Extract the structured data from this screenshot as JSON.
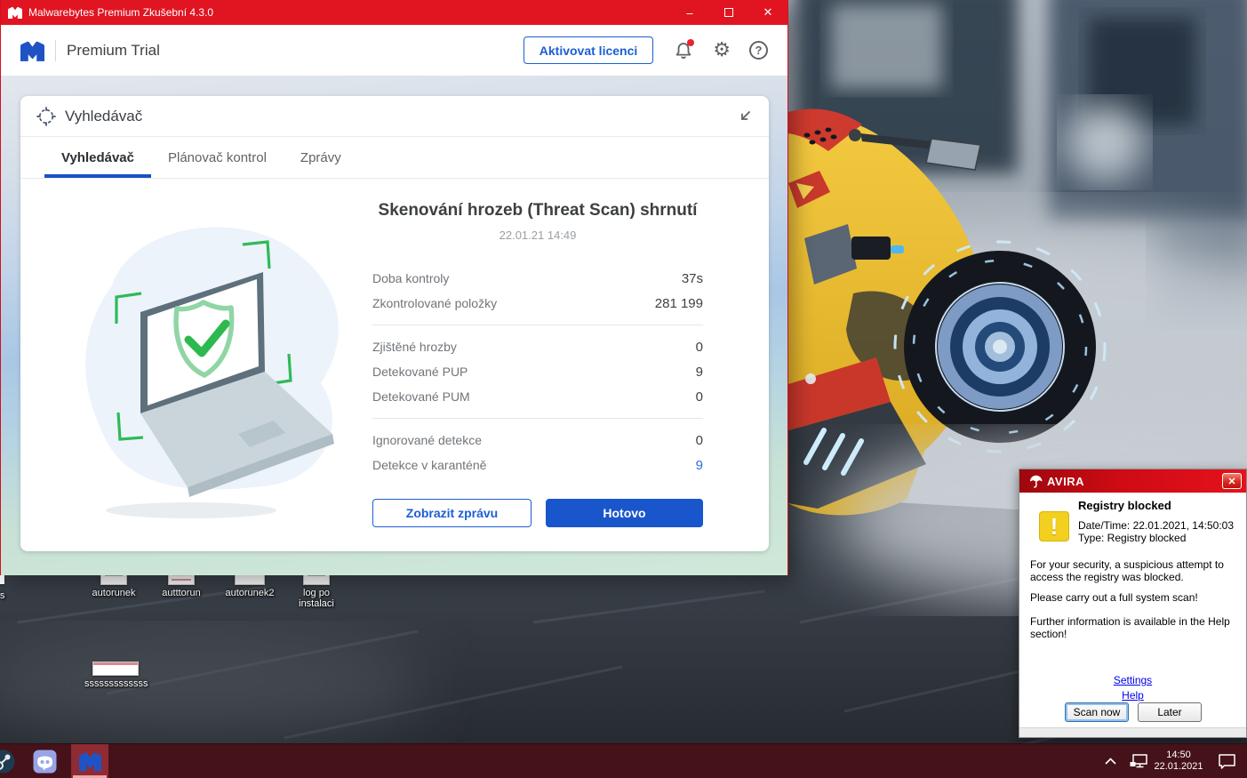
{
  "colors": {
    "titlebar_red": "#e11422",
    "accent_blue": "#1b5fd3",
    "done_button_blue": "#1956cc",
    "active_tab_underline": "#1b50c8",
    "quarantine_value_blue": "#2a6fdb",
    "avira_red": "#cf0b14",
    "taskbar_maroon": "#451219",
    "shield_green": "#2eb94f"
  },
  "mb": {
    "titlebar": {
      "title": "Malwarebytes Premium Zkušební  4.3.0",
      "minimize_glyph": "–",
      "close_glyph": "✕"
    },
    "header": {
      "product": "Premium Trial",
      "activate_button": "Aktivovat licenci",
      "gear_glyph": "⚙",
      "help_glyph": "?"
    },
    "panel": {
      "title": "Vyhledávač"
    },
    "tabs": [
      {
        "label": "Vyhledávač",
        "active": true
      },
      {
        "label": "Plánovač kontrol",
        "active": false
      },
      {
        "label": "Zprávy",
        "active": false
      }
    ],
    "summary": {
      "title": "Skenování hrozeb (Threat Scan) shrnutí",
      "datetime": "22.01.21 14:49",
      "stats": [
        {
          "label": "Doba kontroly",
          "value": "37s"
        },
        {
          "label": "Zkontrolované položky",
          "value": "281 199"
        },
        {
          "label": "Zjištěné hrozby",
          "value": "0"
        },
        {
          "label": "Detekované PUP",
          "value": "9"
        },
        {
          "label": "Detekované PUM",
          "value": "0"
        },
        {
          "label": "Ignorované detekce",
          "value": "0"
        },
        {
          "label": "Detekce v karanténě",
          "value": "9"
        }
      ],
      "report_button": "Zobrazit zprávu",
      "done_button": "Hotovo"
    }
  },
  "avira": {
    "brand": "AVIRA",
    "close_glyph": "✕",
    "warning_glyph": "!",
    "title": "Registry blocked",
    "date_line": "Date/Time: 22.01.2021, 14:50:03",
    "type_line": "Type: Registry blocked",
    "p1": "For your security, a suspicious attempt to access the registry was blocked.",
    "p2": "Please carry out a full system scan!",
    "p3": "Further information is available in the Help section!",
    "settings_link": "Settings",
    "help_link": "Help",
    "scan_now_button": "Scan now",
    "later_button": "Later"
  },
  "desktop": {
    "partial_label": "s",
    "icons": [
      {
        "label": "autorunek"
      },
      {
        "label": "autttorun"
      },
      {
        "label": "autorunek2"
      },
      {
        "label": "log po instalaci"
      },
      {
        "label": "sssssssssssss"
      }
    ]
  },
  "taskbar": {
    "time": "14:50",
    "date": "22.01.2021"
  }
}
